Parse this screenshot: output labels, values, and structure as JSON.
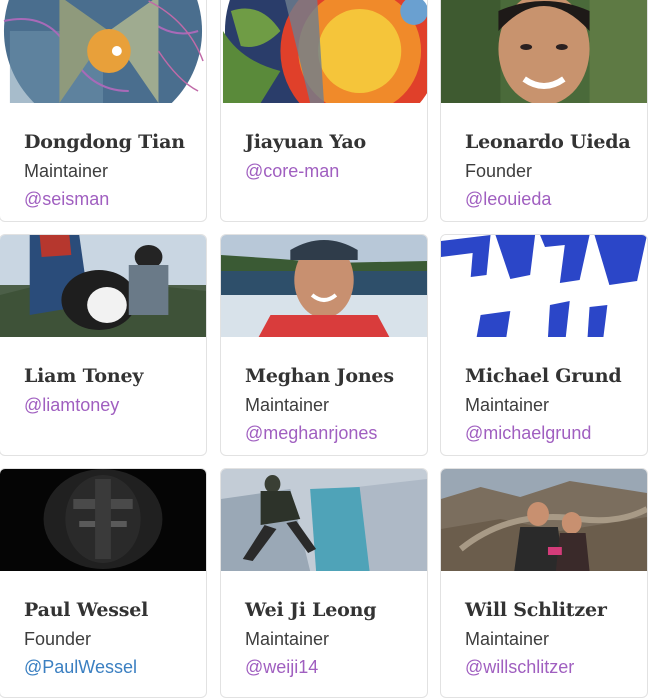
{
  "people": [
    {
      "name": "Dongdong Tian",
      "role": "Maintainer",
      "handle": "@seisman",
      "photo": "earth-globe-cutaway-image"
    },
    {
      "name": "Jiayuan Yao",
      "role": "",
      "handle": "@core-man",
      "photo": "earth-core-cross-section-image"
    },
    {
      "name": "Leonardo Uieda",
      "role": "Founder",
      "handle": "@leouieda",
      "photo": "portrait-photo"
    },
    {
      "name": "Liam Toney",
      "role": "",
      "handle": "@liamtoney",
      "photo": "person-with-dog-photo"
    },
    {
      "name": "Meghan Jones",
      "role": "Maintainer",
      "handle": "@meghanrjones",
      "photo": "person-at-coast-photo"
    },
    {
      "name": "Michael Grund",
      "role": "Maintainer",
      "handle": "@michaelgrund",
      "photo": "blue-text-art-image"
    },
    {
      "name": "Paul Wessel",
      "role": "Founder",
      "handle": "@PaulWessel",
      "photo": "dark-portrait-image"
    },
    {
      "name": "Wei Ji Leong",
      "role": "Maintainer",
      "handle": "@weiji14",
      "photo": "person-jumping-ice-photo"
    },
    {
      "name": "Will Schlitzer",
      "role": "Maintainer",
      "handle": "@willschlitzer",
      "photo": "couple-great-wall-photo"
    }
  ],
  "colors": {
    "handle": "#a05fc0",
    "handle_visited": "#3a7fc1",
    "name": "#333333",
    "role": "#3d3d3d"
  }
}
